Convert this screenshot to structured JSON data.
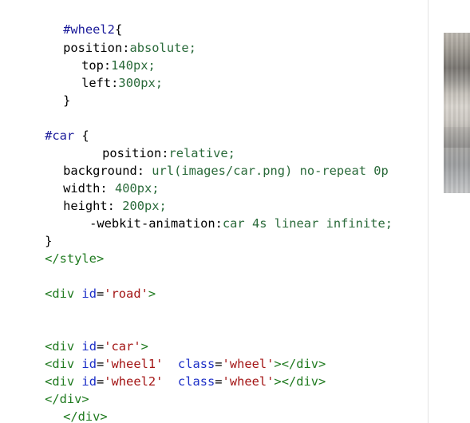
{
  "css": {
    "wheel2": {
      "selector": "#wheel2",
      "brace_open": "{",
      "position_prop": "position:",
      "position_val": "absolute;",
      "top_prop": "top:",
      "top_val": "140px;",
      "left_prop": "left:",
      "left_val": "300px;",
      "brace_close": "}"
    },
    "car": {
      "selector": "#car",
      "brace_open": " {",
      "position_prop": "position:",
      "position_val": "relative;",
      "background_prop": "background:",
      "background_val": " url(images/car.png) no-repeat 0p",
      "width_prop": "width:",
      "width_val": " 400px;",
      "height_prop": "height:",
      "height_val": " 200px;",
      "animation_prop": "-webkit-animation:",
      "animation_val": "car 4s linear infinite;",
      "brace_close": "}"
    },
    "style_close": "</style>"
  },
  "html": {
    "road": {
      "open": "<div",
      "attr": " id",
      "eq": "=",
      "value": "'road'",
      "close": ">"
    },
    "car": {
      "open": "<div",
      "attr": " id",
      "eq": "=",
      "value": "'car'",
      "close": ">"
    },
    "wheel1": {
      "open": "<div",
      "id_attr": " id",
      "id_eq": "=",
      "id_value": "'wheel1'",
      "class_attr": "  class",
      "class_eq": "=",
      "class_value": "'wheel'",
      "close": "></div>"
    },
    "wheel2": {
      "open": "<div",
      "id_attr": " id",
      "id_eq": "=",
      "id_value": "'wheel2'",
      "class_attr": "  class",
      "class_eq": "=",
      "class_value": "'wheel'",
      "close": "></div>"
    },
    "close_div_1": "</div>",
    "close_div_2": "</div>"
  },
  "colors": {
    "selector": "#1b1b9a",
    "value": "#2a6a3a",
    "tag": "#1f7a1f",
    "attribute": "#1c2fc7",
    "string": "#a31515"
  }
}
